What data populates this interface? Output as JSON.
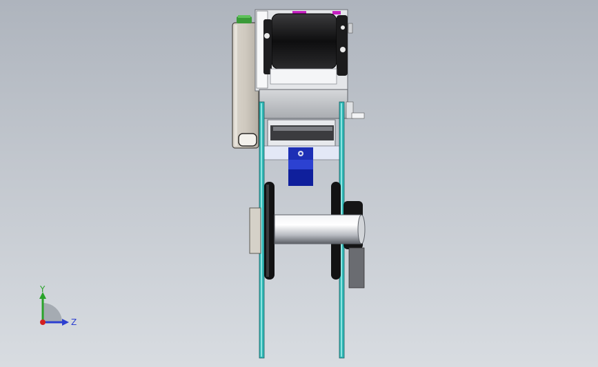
{
  "triad": {
    "y_label": "Y",
    "z_label": "Z"
  },
  "colors": {
    "teal": "#2fb7b5",
    "blue_block": "#1d2fb5",
    "magenta_mark": "#c51fbf",
    "green_fitting": "#41a83f"
  }
}
